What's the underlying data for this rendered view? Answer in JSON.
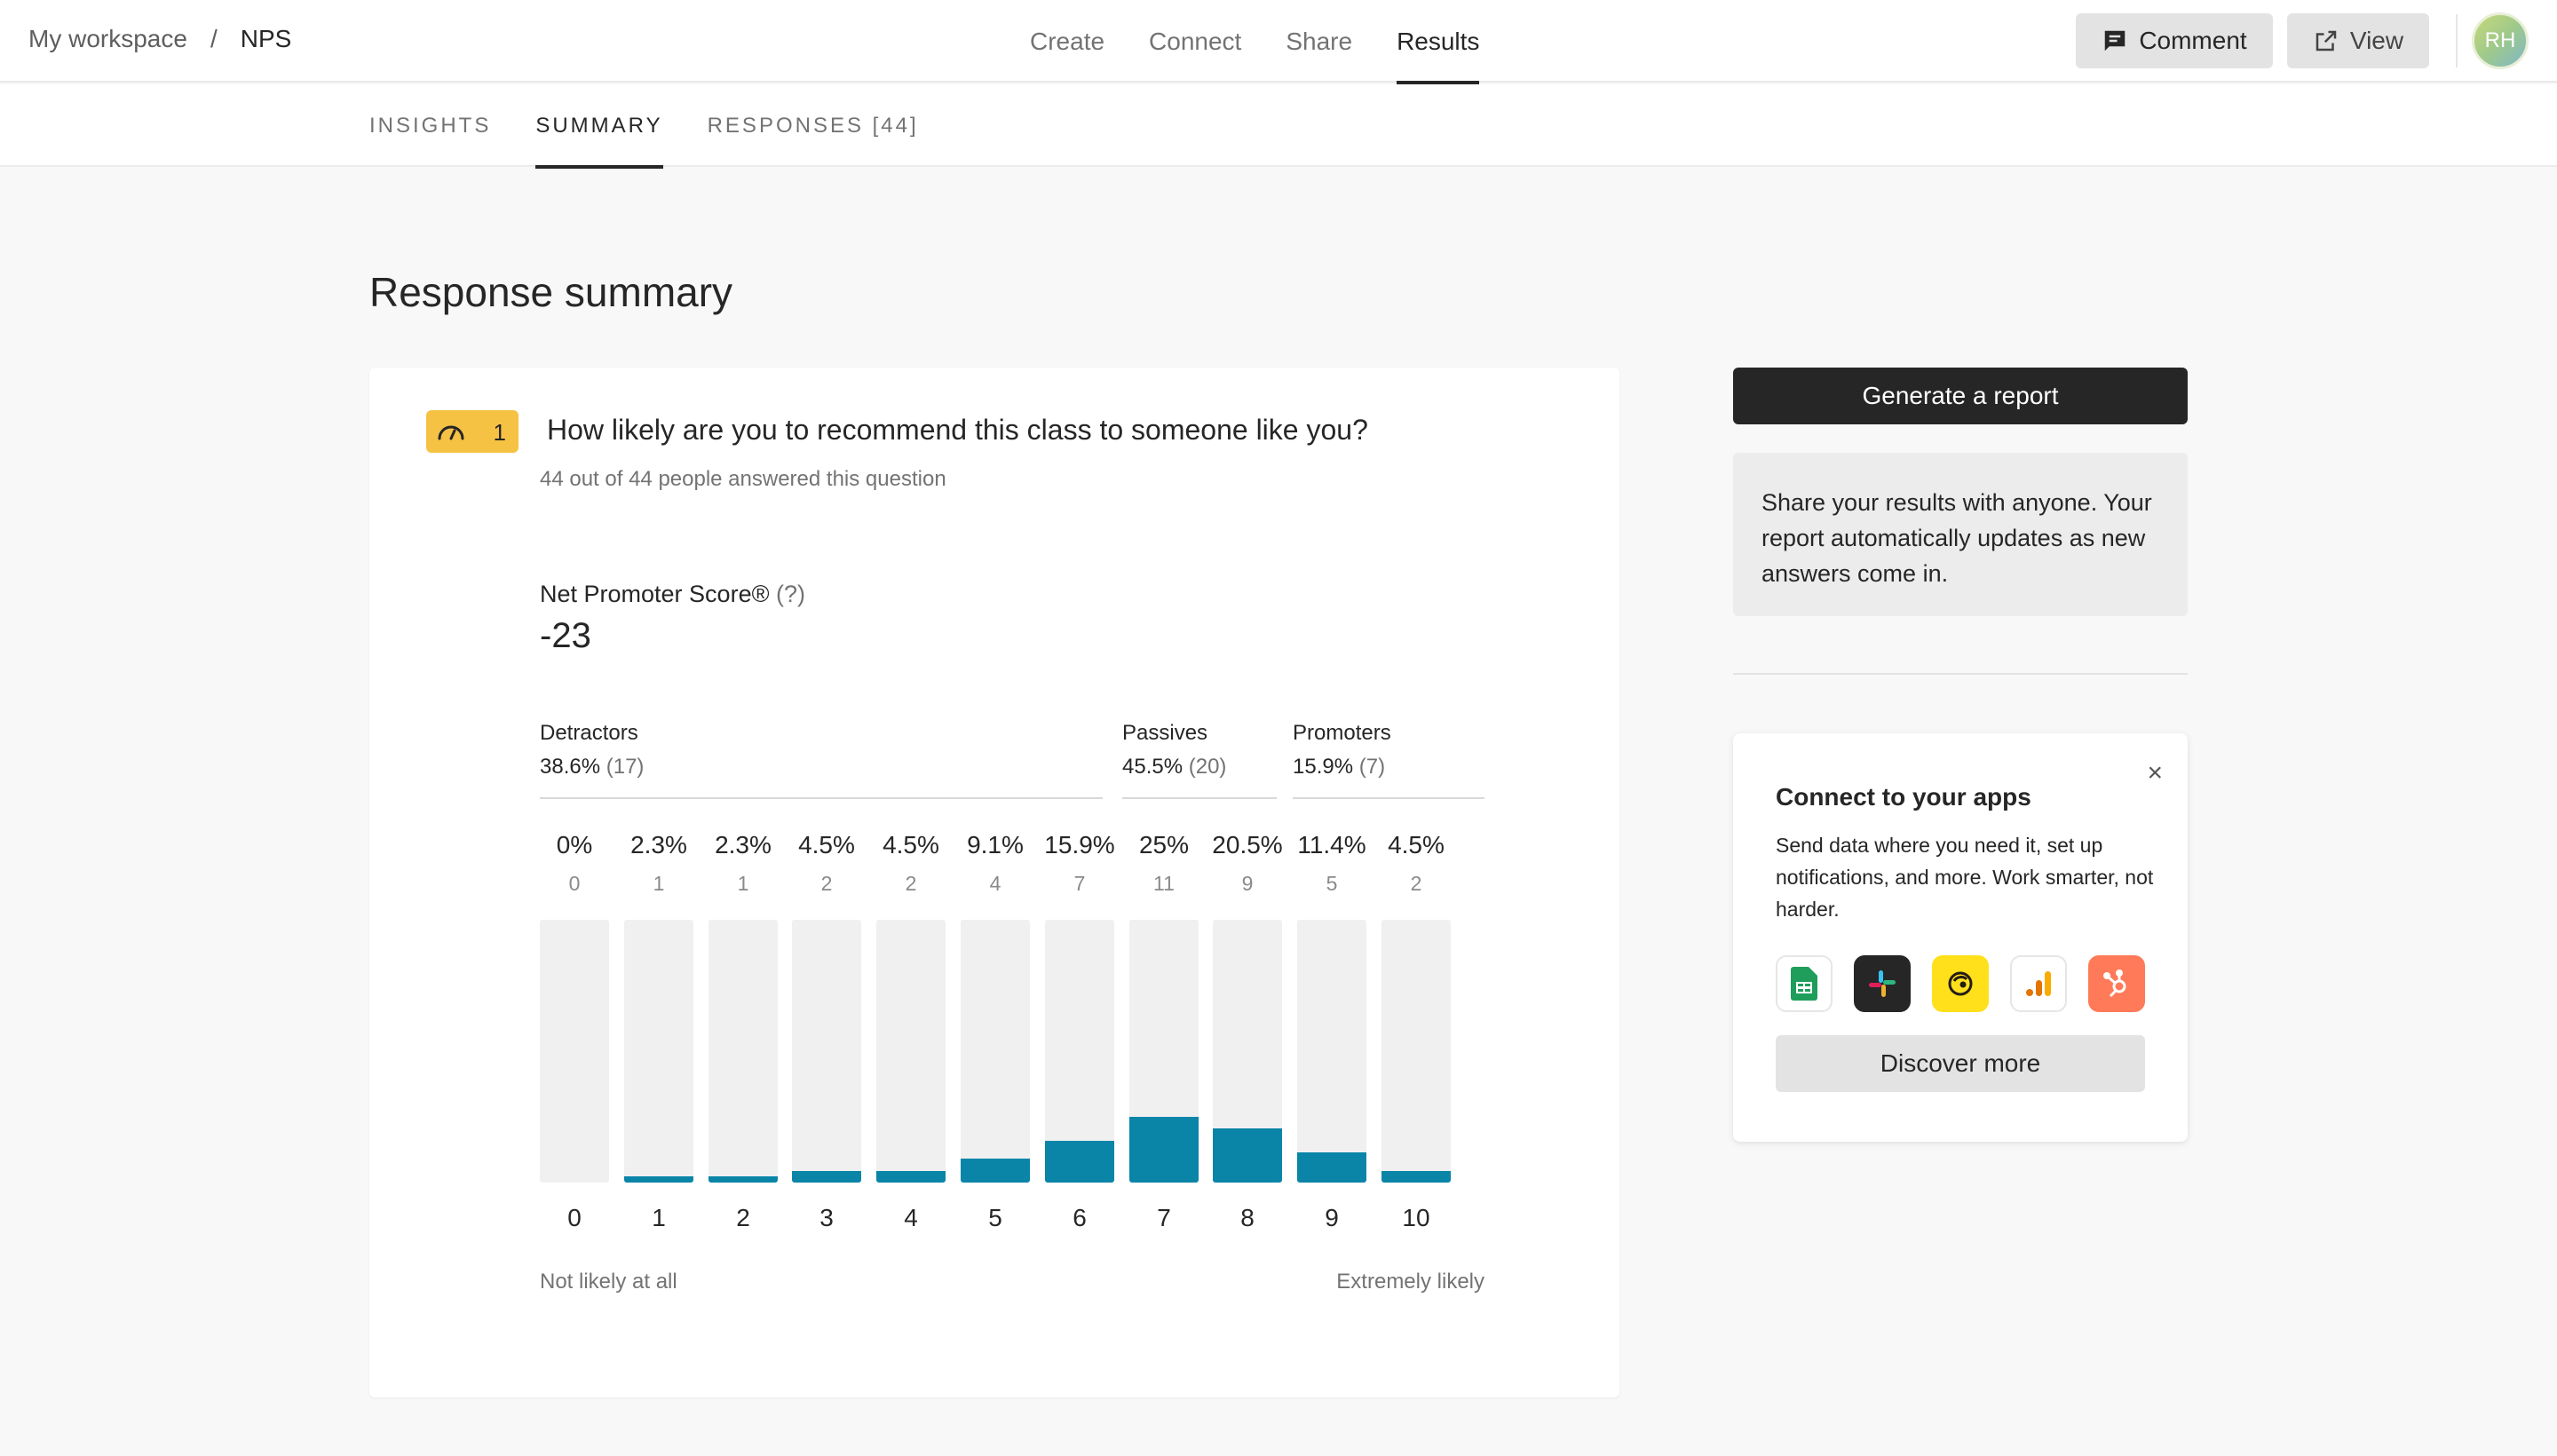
{
  "breadcrumb": {
    "workspace": "My workspace",
    "separator": "/",
    "current": "NPS"
  },
  "nav": {
    "items": [
      "Create",
      "Connect",
      "Share",
      "Results"
    ],
    "active": "Results"
  },
  "toolbar": {
    "comment_label": "Comment",
    "view_label": "View",
    "avatar_initials": "RH"
  },
  "subtabs": {
    "items": [
      "INSIGHTS",
      "SUMMARY",
      "RESPONSES [44]"
    ],
    "active": "SUMMARY"
  },
  "page_title": "Response summary",
  "question": {
    "number": "1",
    "title": "How likely are you to recommend this class to someone like you?",
    "answered": "44 out of 44 people answered this question"
  },
  "nps": {
    "label": "Net Promoter Score®",
    "help": "(?)",
    "value": "-23"
  },
  "groups": {
    "detractors": {
      "name": "Detractors",
      "pct": "38.6%",
      "count": "(17)"
    },
    "passives": {
      "name": "Passives",
      "pct": "45.5%",
      "count": "(20)"
    },
    "promoters": {
      "name": "Promoters",
      "pct": "15.9%",
      "count": "(7)"
    }
  },
  "chart_data": {
    "type": "bar",
    "categories": [
      "0",
      "1",
      "2",
      "3",
      "4",
      "5",
      "6",
      "7",
      "8",
      "9",
      "10"
    ],
    "percent_labels": [
      "0%",
      "2.3%",
      "2.3%",
      "4.5%",
      "4.5%",
      "9.1%",
      "15.9%",
      "25%",
      "20.5%",
      "11.4%",
      "4.5%"
    ],
    "counts": [
      0,
      1,
      1,
      2,
      2,
      4,
      7,
      11,
      9,
      5,
      2
    ],
    "percent_values": [
      0,
      2.3,
      2.3,
      4.5,
      4.5,
      9.1,
      15.9,
      25,
      20.5,
      11.4,
      4.5
    ],
    "ylim": [
      0,
      100
    ],
    "bar_color": "#0a85a8",
    "track_color": "#f0f0f0",
    "axis_left_label": "Not likely at all",
    "axis_right_label": "Extremely likely"
  },
  "sidebar": {
    "generate_label": "Generate a report",
    "share_text": "Share your results with anyone. Your report automatically updates as new answers come in.",
    "apps": {
      "title": "Connect to your apps",
      "description": "Send data where you need it, set up notifications, and more. Work smarter, not harder.",
      "close": "×",
      "icons": [
        "google-sheets-icon",
        "slack-icon",
        "mailchimp-icon",
        "google-analytics-icon",
        "hubspot-icon"
      ],
      "discover_label": "Discover more"
    }
  },
  "colors": {
    "accent": "#0a85a8",
    "badge": "#f6c244",
    "dark": "#262627"
  }
}
